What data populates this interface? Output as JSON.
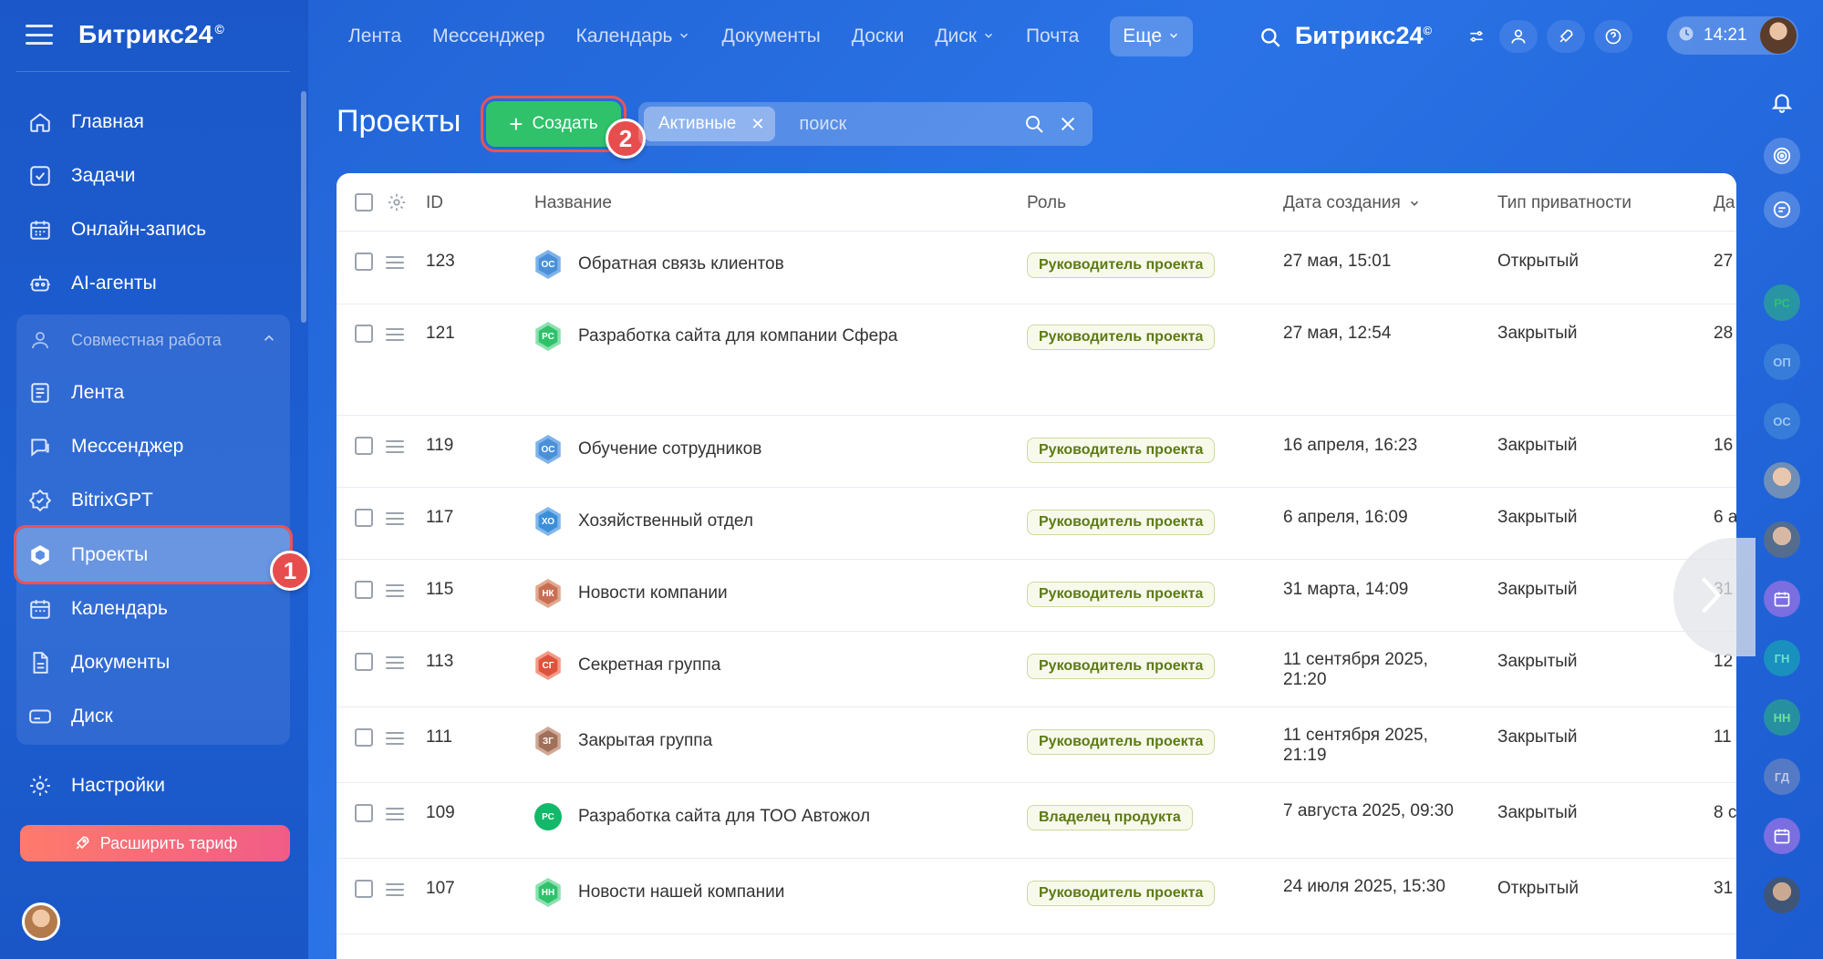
{
  "brand": {
    "name": "Битрикс24",
    "mark": "©"
  },
  "sidebar": {
    "items": [
      {
        "label": "Главная"
      },
      {
        "label": "Задачи"
      },
      {
        "label": "Онлайн-запись"
      },
      {
        "label": "AI-агенты"
      }
    ],
    "group": {
      "label": "Совместная работа",
      "items": [
        {
          "label": "Лента"
        },
        {
          "label": "Мессенджер"
        },
        {
          "label": "BitrixGPT"
        },
        {
          "label": "Проекты"
        },
        {
          "label": "Календарь"
        },
        {
          "label": "Документы"
        },
        {
          "label": "Диск"
        }
      ]
    },
    "settings": "Настройки",
    "upgrade": "Расширить тариф"
  },
  "topnav": {
    "items": [
      "Лента",
      "Мессенджер",
      "Календарь",
      "Документы",
      "Доски",
      "Диск",
      "Почта"
    ],
    "more": "Еще",
    "brand": "Битрикс24",
    "time": "14:21"
  },
  "page": {
    "title": "Проекты",
    "create_label": "Создать",
    "filter_chip": "Активные",
    "search_placeholder": "поиск"
  },
  "steps": {
    "one": "1",
    "two": "2"
  },
  "table": {
    "columns": {
      "id": "ID",
      "name": "Название",
      "role": "Роль",
      "created": "Дата создания",
      "privacy": "Тип приватности",
      "more": "Да"
    },
    "rows": [
      {
        "id": "123",
        "abbr": "ОС",
        "name": "Обратная связь клиентов",
        "role": "Руководитель проекта",
        "date": "27 мая, 15:01",
        "privacy": "Открытый",
        "extra": "27",
        "color": "#4a90d9"
      },
      {
        "id": "121",
        "abbr": "РС",
        "name": "Разработка сайта для компании Сфера",
        "role": "Руководитель проекта",
        "date": "27 мая, 12:54",
        "privacy": "Закрытый",
        "extra": "28",
        "color": "#2fc26b"
      },
      {
        "id": "119",
        "abbr": "ОС",
        "name": "Обучение сотрудников",
        "role": "Руководитель проекта",
        "date": "16 апреля, 16:23",
        "privacy": "Закрытый",
        "extra": "16",
        "color": "#4a90d9"
      },
      {
        "id": "117",
        "abbr": "ХО",
        "name": "Хозяйственный отдел",
        "role": "Руководитель проекта",
        "date": "6 апреля, 16:09",
        "privacy": "Закрытый",
        "extra": "6 а",
        "color": "#3b8fd8"
      },
      {
        "id": "115",
        "abbr": "НК",
        "name": "Новости компании",
        "role": "Руководитель проекта",
        "date": "31 марта, 14:09",
        "privacy": "Закрытый",
        "extra": "31",
        "color": "#c86f52"
      },
      {
        "id": "113",
        "abbr": "СГ",
        "name": "Секретная группа",
        "role": "Руководитель проекта",
        "date": "11 сентября 2025, 21:20",
        "privacy": "Закрытый",
        "extra": "12",
        "color": "#e0523a"
      },
      {
        "id": "111",
        "abbr": "ЗГ",
        "name": "Закрытая группа",
        "role": "Руководитель проекта",
        "date": "11 сентября 2025, 21:19",
        "privacy": "Закрытый",
        "extra": "11",
        "color": "#a0705a"
      },
      {
        "id": "109",
        "abbr": "РС",
        "name": "Разработка сайта для ТОО Автожол",
        "role": "Владелец продукта",
        "date": "7 августа 2025, 09:30",
        "privacy": "Закрытый",
        "extra": "8 с",
        "color": "#14b86a"
      },
      {
        "id": "107",
        "abbr": "НН",
        "name": "Новости нашей компании",
        "role": "Руководитель проекта",
        "date": "24 июля 2025, 15:30",
        "privacy": "Открытый",
        "extra": "31",
        "color": "#2fc26b"
      }
    ]
  },
  "rail": {
    "items": [
      {
        "type": "bell-icon"
      },
      {
        "type": "target-icon"
      },
      {
        "type": "chat-icon"
      },
      {
        "abbr": "РС"
      },
      {
        "abbr": "ОП"
      },
      {
        "abbr": "ОС"
      },
      {
        "type": "avatar"
      },
      {
        "type": "avatar"
      },
      {
        "type": "calendar-icon"
      },
      {
        "abbr": "ГН"
      },
      {
        "abbr": "НН"
      },
      {
        "abbr": "ГД"
      },
      {
        "type": "calendar-icon"
      },
      {
        "type": "avatar"
      }
    ]
  },
  "colors": {
    "accent": "#2fc26b",
    "highlight": "#e85454",
    "primary": "#1f5fd1"
  }
}
